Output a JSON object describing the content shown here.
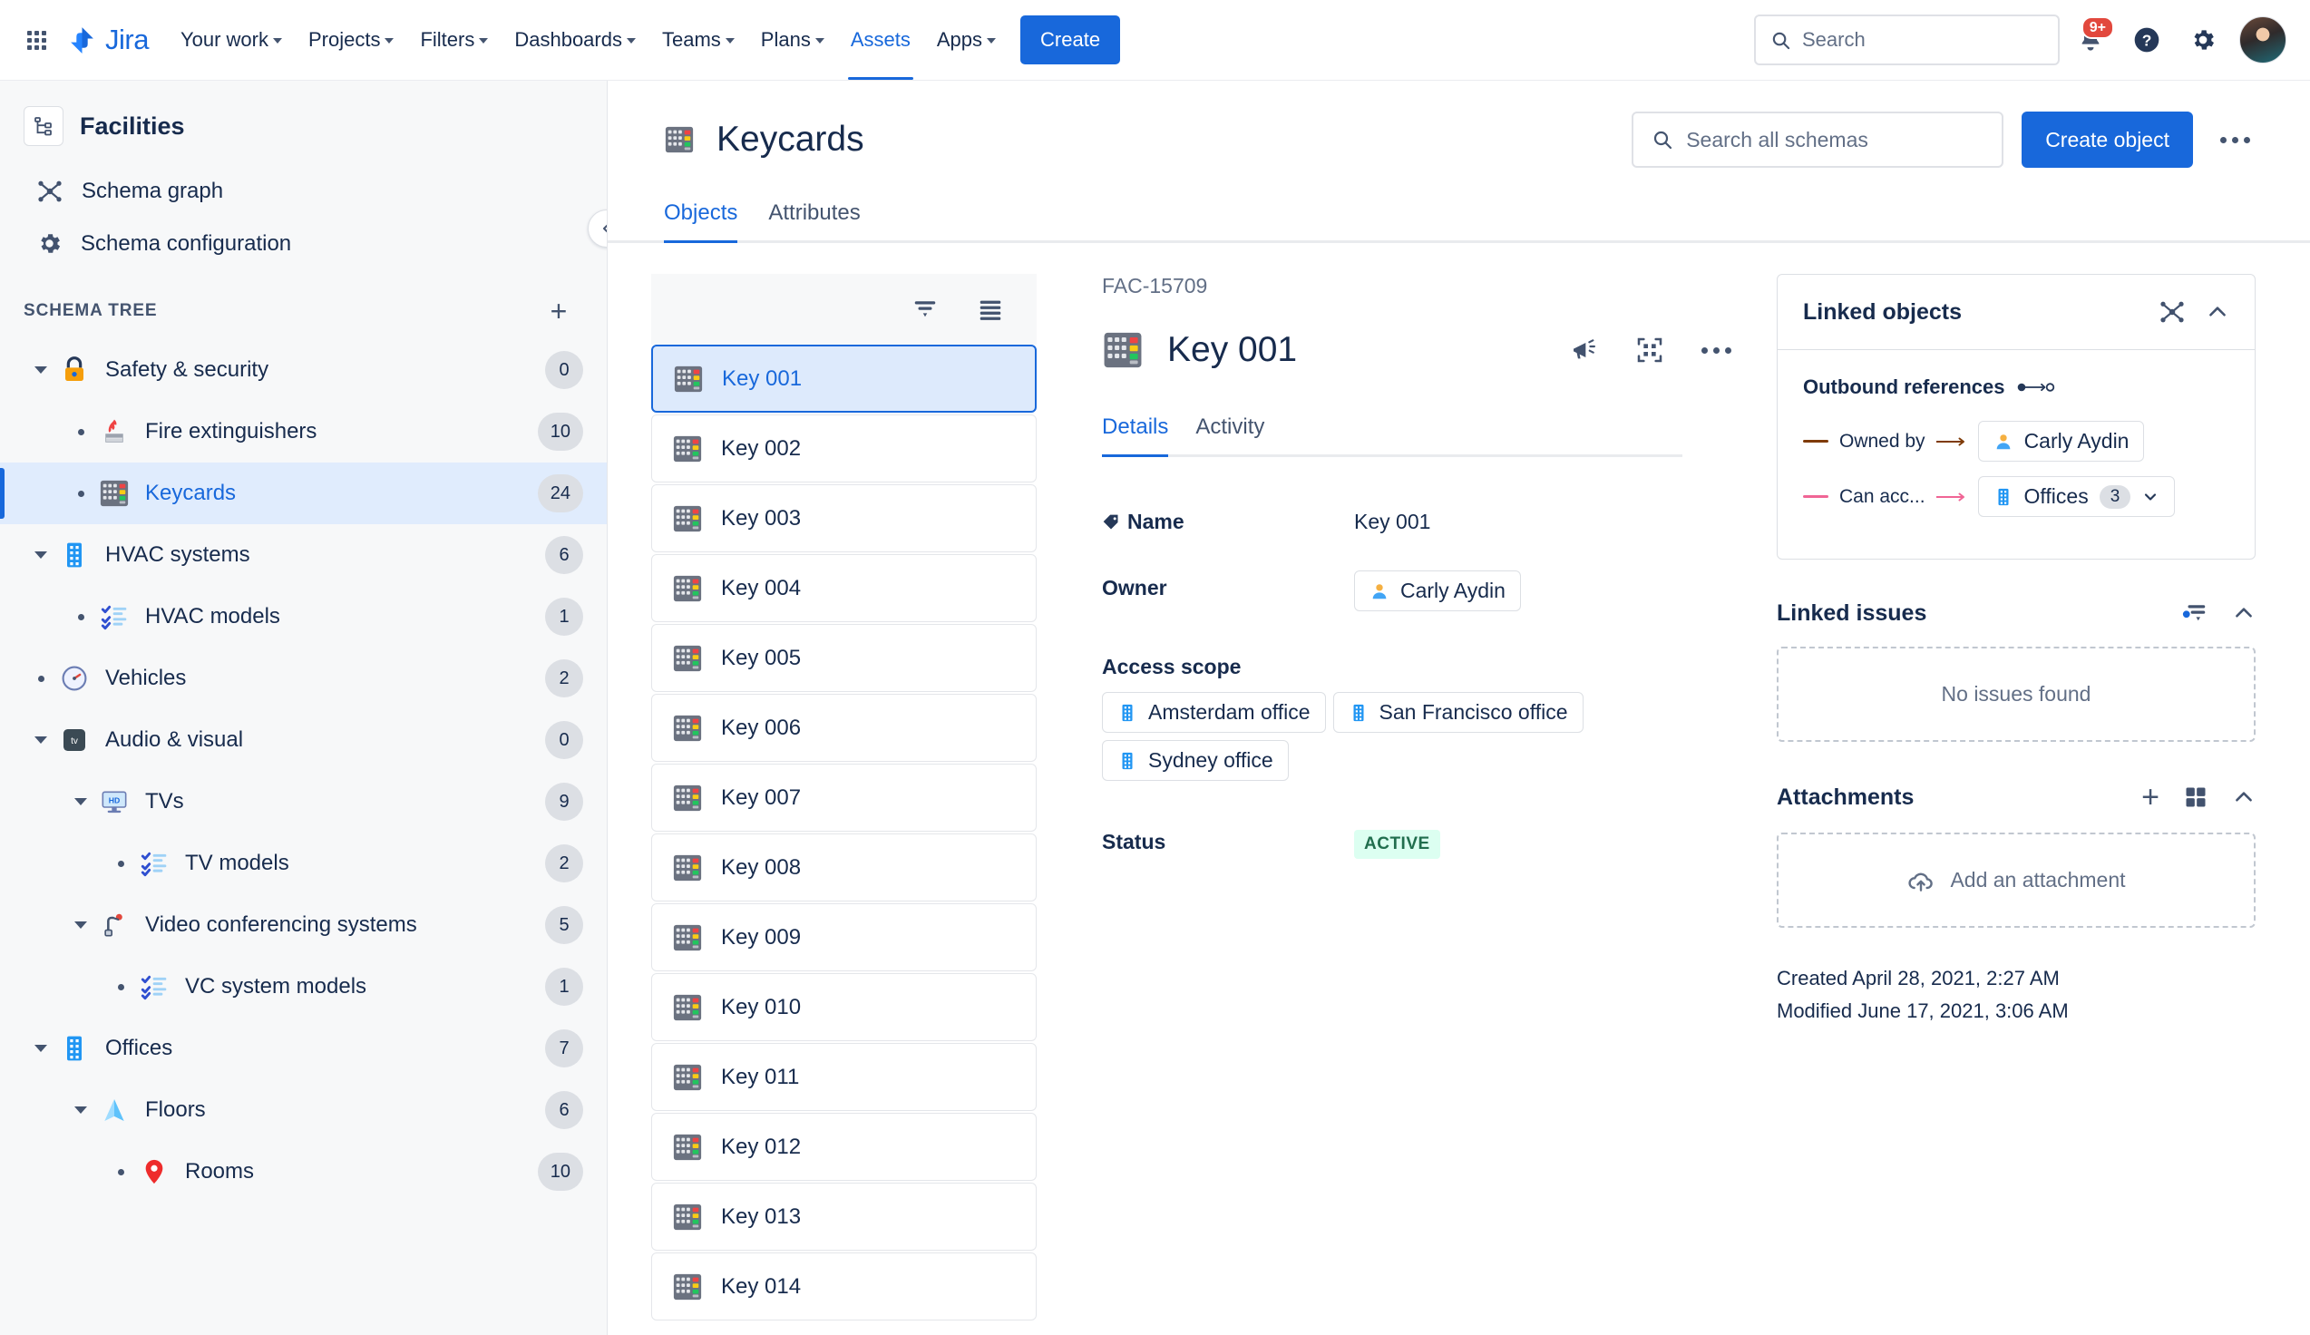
{
  "topnav": {
    "app_switcher_icon": "grid-apps-icon",
    "brand": "Jira",
    "items": [
      {
        "label": "Your work",
        "has_caret": true,
        "active": false
      },
      {
        "label": "Projects",
        "has_caret": true,
        "active": false
      },
      {
        "label": "Filters",
        "has_caret": true,
        "active": false
      },
      {
        "label": "Dashboards",
        "has_caret": true,
        "active": false
      },
      {
        "label": "Teams",
        "has_caret": true,
        "active": false
      },
      {
        "label": "Plans",
        "has_caret": true,
        "active": false
      },
      {
        "label": "Assets",
        "has_caret": false,
        "active": true
      },
      {
        "label": "Apps",
        "has_caret": true,
        "active": false
      }
    ],
    "create_label": "Create",
    "search_placeholder": "Search",
    "notifications_badge": "9+",
    "help_icon": "question-circle-icon",
    "settings_icon": "gear-icon",
    "avatar_icon": "user-avatar"
  },
  "sidebar": {
    "schema_icon": "schema-hierarchy-icon",
    "schema_name": "Facilities",
    "collapse_icon": "chevron-left-icon",
    "links": [
      {
        "label": "Schema graph",
        "icon": "graph-nodes-icon"
      },
      {
        "label": "Schema configuration",
        "icon": "gear-icon"
      }
    ],
    "section_title": "SCHEMA TREE",
    "add_icon": "plus-icon",
    "tree": [
      {
        "label": "Safety & security",
        "count": "0",
        "depth": 0,
        "twisty": "chevron-down",
        "emoji": "🔒",
        "selected": false
      },
      {
        "label": "Fire extinguishers",
        "count": "10",
        "depth": 1,
        "twisty": "dot",
        "emoji": "🧯",
        "selected": false
      },
      {
        "label": "Keycards",
        "count": "24",
        "depth": 1,
        "twisty": "dot",
        "emoji": "keypad",
        "selected": true
      },
      {
        "label": "HVAC systems",
        "count": "6",
        "depth": 0,
        "twisty": "chevron-down",
        "emoji": "🏢",
        "selected": false
      },
      {
        "label": "HVAC models",
        "count": "1",
        "depth": 1,
        "twisty": "dot",
        "emoji": "☑",
        "selected": false
      },
      {
        "label": "Vehicles",
        "count": "2",
        "depth": 0,
        "twisty": "dot",
        "emoji": "🕐",
        "selected": false
      },
      {
        "label": "Audio & visual",
        "count": "0",
        "depth": 0,
        "twisty": "chevron-down",
        "emoji": "📺",
        "selected": false
      },
      {
        "label": "TVs",
        "count": "9",
        "depth": 1,
        "twisty": "chevron-down",
        "emoji": "🖥",
        "selected": false
      },
      {
        "label": "TV models",
        "count": "2",
        "depth": 2,
        "twisty": "dot",
        "emoji": "☑",
        "selected": false
      },
      {
        "label": "Video conferencing systems",
        "count": "5",
        "depth": 1,
        "twisty": "chevron-down",
        "emoji": "🎙",
        "selected": false
      },
      {
        "label": "VC system models",
        "count": "1",
        "depth": 2,
        "twisty": "dot",
        "emoji": "☑",
        "selected": false
      },
      {
        "label": "Offices",
        "count": "7",
        "depth": 0,
        "twisty": "chevron-down",
        "emoji": "🏢",
        "selected": false
      },
      {
        "label": "Floors",
        "count": "6",
        "depth": 1,
        "twisty": "chevron-down",
        "emoji": "🔺",
        "selected": false
      },
      {
        "label": "Rooms",
        "count": "10",
        "depth": 2,
        "twisty": "dot",
        "emoji": "📍",
        "selected": false
      }
    ]
  },
  "main": {
    "page_icon": "keypad-icon",
    "page_title": "Keycards",
    "search_placeholder": "Search all schemas",
    "create_object_label": "Create object",
    "more_icon": "more-horizontal-icon",
    "tabs": [
      {
        "label": "Objects",
        "active": true
      },
      {
        "label": "Attributes",
        "active": false
      }
    ]
  },
  "objlist": {
    "filter_icon": "filter-icon",
    "list_view_icon": "list-view-icon",
    "items": [
      {
        "label": "Key 001",
        "selected": true
      },
      {
        "label": "Key 002",
        "selected": false
      },
      {
        "label": "Key 003",
        "selected": false
      },
      {
        "label": "Key 004",
        "selected": false
      },
      {
        "label": "Key 005",
        "selected": false
      },
      {
        "label": "Key 006",
        "selected": false
      },
      {
        "label": "Key 007",
        "selected": false
      },
      {
        "label": "Key 008",
        "selected": false
      },
      {
        "label": "Key 009",
        "selected": false
      },
      {
        "label": "Key 010",
        "selected": false
      },
      {
        "label": "Key 011",
        "selected": false
      },
      {
        "label": "Key 012",
        "selected": false
      },
      {
        "label": "Key 013",
        "selected": false
      },
      {
        "label": "Key 014",
        "selected": false
      }
    ]
  },
  "detail": {
    "object_key": "FAC-15709",
    "object_title": "Key 001",
    "object_icon": "keypad-icon",
    "action_icons": [
      "megaphone-icon",
      "qr-code-icon",
      "more-horizontal-icon"
    ],
    "tabs": [
      {
        "label": "Details",
        "active": true
      },
      {
        "label": "Activity",
        "active": false
      }
    ],
    "fields": {
      "name_label": "Name",
      "name_value": "Key 001",
      "owner_label": "Owner",
      "owner_value": "Carly Aydin",
      "access_scope_label": "Access scope",
      "access_scope_values": [
        "Amsterdam office",
        "San Francisco office",
        "Sydney office"
      ],
      "status_label": "Status",
      "status_value": "ACTIVE"
    }
  },
  "rail": {
    "linked_objects": {
      "title": "Linked objects",
      "graph_icon": "graph-nodes-icon",
      "collapse_icon": "chevron-up-icon",
      "outbound_title": "Outbound references",
      "refs": [
        {
          "label": "Owned by",
          "target": "Carly Aydin",
          "target_icon": "person-icon",
          "color": "#7f3b08",
          "count": null
        },
        {
          "label": "Can acc...",
          "target": "Offices",
          "target_icon": "office-building-icon",
          "color": "#f museum",
          "count": "3"
        }
      ]
    },
    "linked_issues": {
      "title": "Linked issues",
      "filter_icon": "filter-icon",
      "collapse_icon": "chevron-up-icon",
      "empty_text": "No issues found"
    },
    "attachments": {
      "title": "Attachments",
      "add_icon": "plus-icon",
      "grid_icon": "grid-view-icon",
      "collapse_icon": "chevron-up-icon",
      "empty_text": "Add an attachment",
      "upload_icon": "cloud-upload-icon"
    },
    "created": "Created April 28, 2021, 2:27 AM",
    "modified": "Modified June 17, 2021, 3:06 AM"
  },
  "colors": {
    "accent": "#1868db",
    "text": "#172b4d",
    "subtle": "#626f86",
    "status_active_bg": "#dcfff1",
    "status_active_fg": "#216e4e",
    "badge_red": "#e2483d"
  }
}
